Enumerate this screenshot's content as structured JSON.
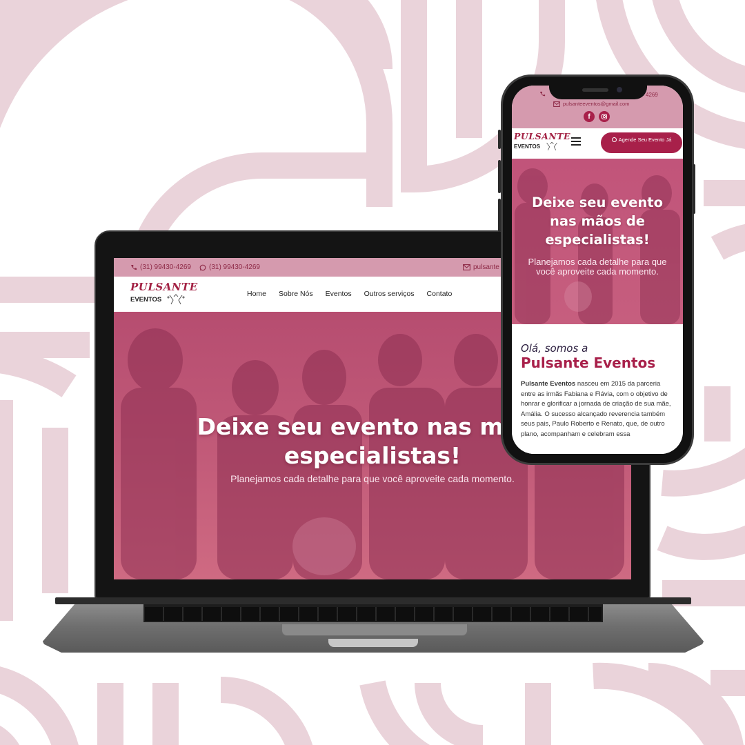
{
  "brand": {
    "name": "PULSANTE",
    "sub": "EVENTOS"
  },
  "colors": {
    "primary": "#a8204a",
    "topbar": "#d59aae",
    "hero": "#c1547a",
    "pattern": "#ead3da"
  },
  "laptop": {
    "topbar": {
      "phone": "(31) 99430-4269",
      "whatsapp": "(31) 99430-4269",
      "email": "pulsante"
    },
    "nav": [
      "Home",
      "Sobre Nós",
      "Eventos",
      "Outros serviços",
      "Contato"
    ],
    "hero": {
      "title_line1": "Deixe seu evento nas mãos",
      "title_line2": "especialistas!",
      "subtitle": "Planejamos cada detalhe para que você aproveite cada momento."
    }
  },
  "phone": {
    "topbar": {
      "phone_partial": "4269",
      "email": "pulsanteeventos@gmail.com"
    },
    "cta": "Agende Seu Evento Já",
    "hero": {
      "title_line1": "Deixe seu evento",
      "title_line2": "nas mãos de",
      "title_line3": "especialistas!",
      "subtitle": "Planejamos cada detalhe para que você aproveite cada momento."
    },
    "about": {
      "intro": "Olá, somos a",
      "name": "Pulsante Eventos",
      "text_bold": "Pulsante Eventos",
      "text": " nasceu em 2015 da parceria entre as irmãs Fabiana e Flávia, com o objetivo de honrar e glorificar a jornada de criação de sua mãe, Amália. O sucesso alcançado reverencia também seus pais, Paulo Roberto e Renato, que, de outro plano, acompanham e celebram essa"
    }
  }
}
